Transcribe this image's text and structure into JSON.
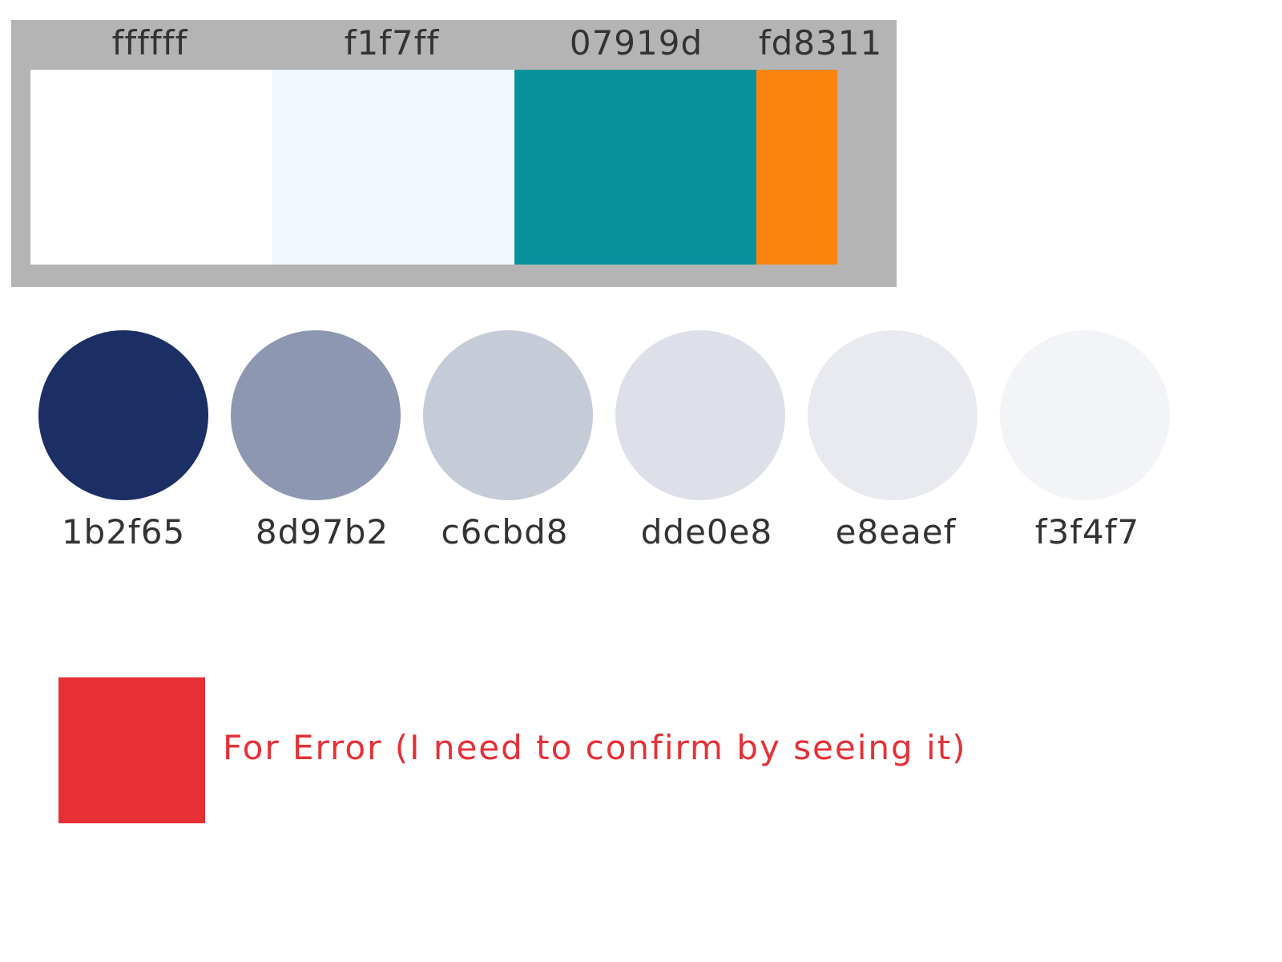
{
  "primary_palette": [
    {
      "label": "ffffff",
      "color": "#ffffff"
    },
    {
      "label": "f1f7ff",
      "color": "#f1f7ff"
    },
    {
      "label": "07919d",
      "color": "#07919d"
    },
    {
      "label": "fd8311",
      "color": "#fd8311"
    }
  ],
  "neutral_palette": [
    {
      "label": "1b2f65",
      "color": "#1b2f65"
    },
    {
      "label": "8d97b2",
      "color": "#8d97b2"
    },
    {
      "label": "c6cbd8",
      "color": "#c6cbd8"
    },
    {
      "label": "dde0e8",
      "color": "#dde0e8"
    },
    {
      "label": "e8eaef",
      "color": "#e8eaef"
    },
    {
      "label": "f3f4f7",
      "color": "#f3f4f7"
    }
  ],
  "error": {
    "color": "#e63036",
    "note": "For Error (I need to confirm by seeing it)"
  },
  "colors": {
    "panel_background": "#b4b4b4",
    "label_text": "#333333"
  }
}
